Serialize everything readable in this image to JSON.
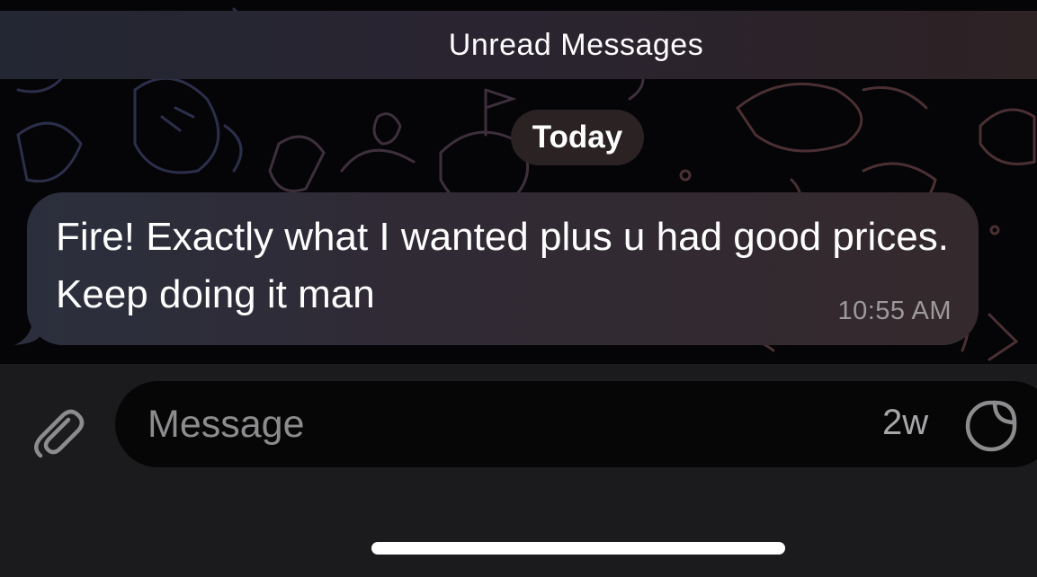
{
  "header": {
    "unread_label": "Unread Messages"
  },
  "chat": {
    "date_label": "Today",
    "messages": [
      {
        "text": "Fire! Exactly what I wanted plus u had good prices. Keep doing it man",
        "time": "10:55 AM"
      }
    ]
  },
  "composer": {
    "placeholder": "Message",
    "timer_label": "2w",
    "attach_icon": "paperclip-icon",
    "sticker_icon": "sticker-icon"
  },
  "colors": {
    "bubble": "#302a35",
    "input_bar": "#1b1a1c",
    "field": "#060606",
    "time_text": "#9c9a9c"
  }
}
